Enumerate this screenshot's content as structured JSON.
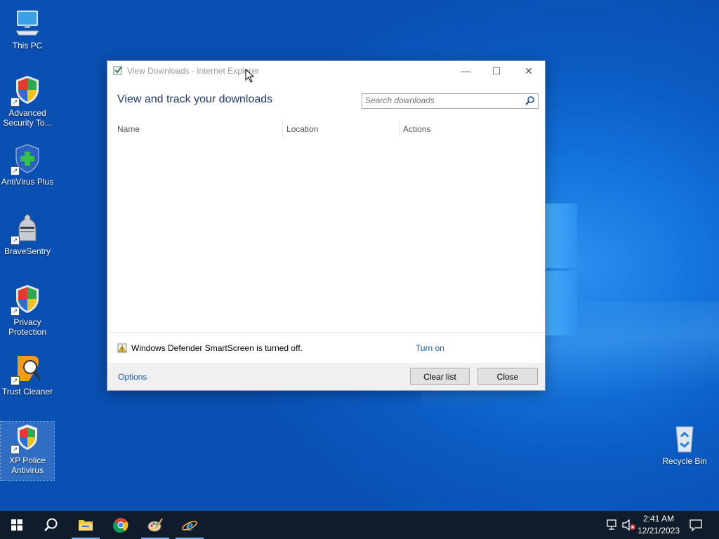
{
  "desktop": {
    "icons": [
      {
        "label": "This PC"
      },
      {
        "label": "Advanced Security To..."
      },
      {
        "label": "AntiVirus Plus"
      },
      {
        "label": "BraveSentry"
      },
      {
        "label": "Privacy Protection"
      },
      {
        "label": "Trust Cleaner"
      },
      {
        "label": "XP Police Antivirus"
      },
      {
        "label": "Recycle Bin"
      }
    ]
  },
  "dialog": {
    "title": "View Downloads - Internet Explorer",
    "heading": "View and track your downloads",
    "search_placeholder": "Search downloads",
    "columns": [
      "Name",
      "Location",
      "Actions"
    ],
    "smartscreen_text": "Windows Defender SmartScreen is turned off.",
    "turn_on_label": "Turn on",
    "options_label": "Options",
    "clear_list_label": "Clear list",
    "close_label": "Close"
  },
  "taskbar": {
    "time": "2:41 AM",
    "date": "12/21/2023"
  }
}
